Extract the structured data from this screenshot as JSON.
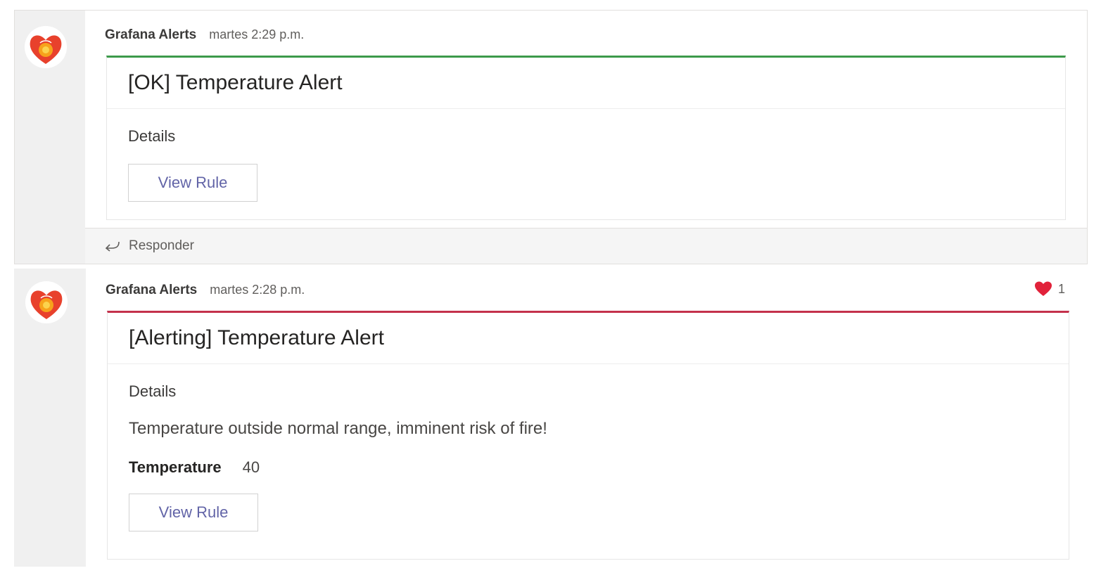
{
  "messages": [
    {
      "sender": "Grafana Alerts",
      "time": "martes 2:29 p.m.",
      "title": "[OK] Temperature Alert",
      "details_label": "Details",
      "button_label": "View Rule",
      "reply_label": "Responder",
      "accent_color": "#3d9a4a"
    },
    {
      "sender": "Grafana Alerts",
      "time": "martes 2:28 p.m.",
      "title": "[Alerting] Temperature Alert",
      "details_label": "Details",
      "message": "Temperature outside normal range, imminent risk of fire!",
      "fact": {
        "key": "Temperature",
        "value": "40"
      },
      "button_label": "View Rule",
      "reaction": {
        "icon": "heart-icon",
        "count": "1"
      },
      "accent_color": "#c4314b"
    }
  ],
  "icons": {
    "avatar": "grafana-logo-icon",
    "reply": "reply-arrow-icon"
  }
}
